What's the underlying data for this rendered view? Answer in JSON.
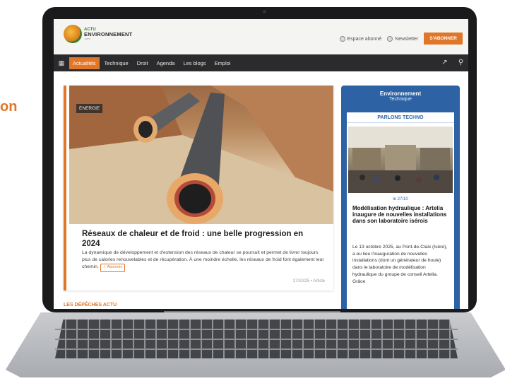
{
  "side_word": "on",
  "header": {
    "logo_top": "ACTU",
    "logo_main": "ENVIRONNEMENT",
    "logo_suffix": ".com",
    "espace_abonne": "Espace abonné",
    "newsletter": "Newsletter",
    "subscribe": "S'ABONNER"
  },
  "nav": {
    "items": [
      "Actualités",
      "Technique",
      "Droit",
      "Agenda",
      "Les blogs",
      "Emploi"
    ],
    "active_index": 0
  },
  "hero": {
    "tag": "ENERGIE",
    "title": "Réseaux de chaleur et de froid : une belle progression en 2024",
    "description": "La dynamique de développement et d'extension des réseaux de chaleur se poursuit et permet de livrer toujours plus de calories renouvelables et de récupération. À une moindre échelle, les réseaux de froid font également leur chemin.",
    "badge": "✓ Abonnés",
    "meta": "27/10/25 • Article"
  },
  "section_heading": "LES DÉPÊCHES ACTU",
  "sidebar": {
    "brand_line1": "Environnement",
    "brand_line2": "Technique",
    "section": "PARLONS TECHNO",
    "date": "le 27/10",
    "title": "Modélisation hydraulique : Artelia inaugure de nouvelles installations dans son laboratoire isérois",
    "text": "Le 13 octobre 2025, au Pont-de-Claix (Isère), a eu lieu l'inauguration de nouvelles installations (dont un générateur de houle) dans le laboratoire de modélisation hydraulique du groupe de conseil Artelia. Grâce"
  },
  "colors": {
    "accent": "#e0762a",
    "nav_bg": "#2b2b2d",
    "sidebar_blue": "#2d62a4"
  },
  "icons": [
    "grid-icon",
    "share-icon",
    "search-icon"
  ]
}
